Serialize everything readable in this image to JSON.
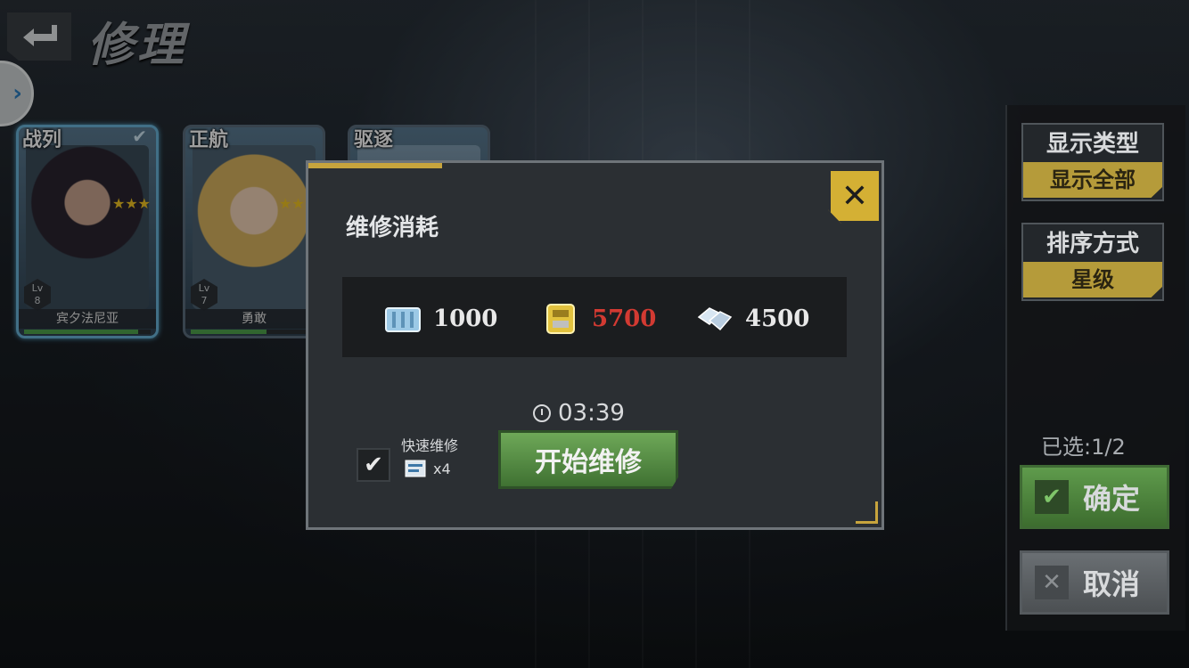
{
  "header": {
    "title": "修理"
  },
  "cards": [
    {
      "type": "战列",
      "level_prefix": "Lv",
      "level": "8",
      "name": "宾夕法尼亚",
      "stars": "★★★",
      "hp": 0.9,
      "selected": true
    },
    {
      "type": "正航",
      "level_prefix": "Lv",
      "level": "7",
      "name": "勇敢",
      "stars": "★★★",
      "hp": 0.6,
      "selected": false
    },
    {
      "type": "驱逐",
      "level_prefix": "",
      "level": "",
      "name": "",
      "stars": "",
      "hp": 0,
      "selected": false
    }
  ],
  "sidebar": {
    "display_type_label": "显示类型",
    "display_type_value": "显示全部",
    "sort_label": "排序方式",
    "sort_value": "星级",
    "selected_count": "已选:1/2",
    "confirm_label": "确定",
    "cancel_label": "取消"
  },
  "dialog": {
    "title": "维修消耗",
    "costs": [
      {
        "icon": "supply-crate-icon",
        "value": "1000",
        "color": "#e8e8e8"
      },
      {
        "icon": "ammo-icon",
        "value": "5700",
        "color": "#d23a32"
      },
      {
        "icon": "steel-icon",
        "value": "4500",
        "color": "#e8e8e8"
      }
    ],
    "timer": "03:39",
    "start_label": "开始维修",
    "fast_repair_label": "快速维修",
    "fast_repair_count": "x4",
    "fast_repair_checked": true
  }
}
